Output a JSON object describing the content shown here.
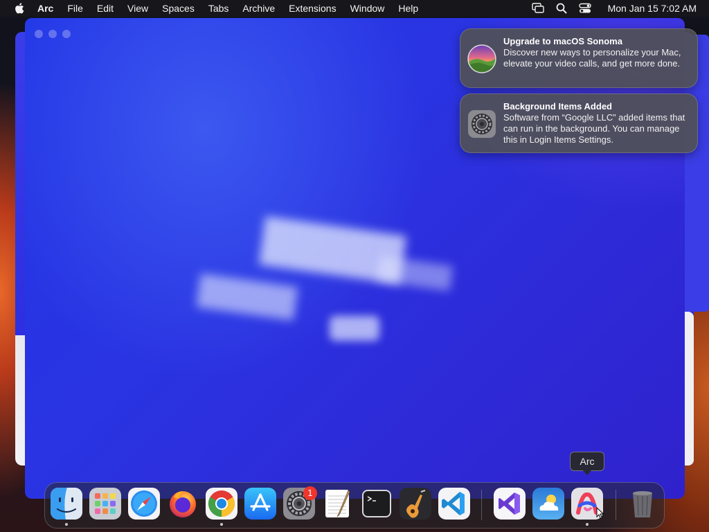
{
  "menubar": {
    "apple_icon": "apple-logo-icon",
    "app_name": "Arc",
    "items": [
      "File",
      "Edit",
      "View",
      "Spaces",
      "Tabs",
      "Archive",
      "Extensions",
      "Window",
      "Help"
    ],
    "status_icons": [
      "screen-mirroring-icon",
      "search-icon",
      "control-center-icon"
    ],
    "clock": "Mon Jan 15  7:02 AM"
  },
  "notifications": [
    {
      "icon": "macos-sonoma-icon",
      "title": "Upgrade to macOS Sonoma",
      "text": "Discover new ways to personalize your Mac, elevate your video calls, and get more done."
    },
    {
      "icon": "system-settings-gear-icon",
      "title": "Background Items Added",
      "text": "Software from “Google LLC” added items that can run in the background. You can manage this in Login Items Settings."
    }
  ],
  "dock": {
    "apps": [
      {
        "name": "Finder",
        "icon": "finder-icon",
        "running": true
      },
      {
        "name": "Launchpad",
        "icon": "launchpad-icon",
        "running": false
      },
      {
        "name": "Safari",
        "icon": "safari-icon",
        "running": false
      },
      {
        "name": "Firefox",
        "icon": "firefox-icon",
        "running": false
      },
      {
        "name": "Google Chrome",
        "icon": "chrome-icon",
        "running": true
      },
      {
        "name": "App Store",
        "icon": "app-store-icon",
        "running": false
      },
      {
        "name": "System Settings",
        "icon": "system-settings-icon",
        "running": false,
        "badge": "1"
      },
      {
        "name": "TextEdit",
        "icon": "textedit-icon",
        "running": false
      },
      {
        "name": "Terminal",
        "icon": "terminal-icon",
        "running": false
      },
      {
        "name": "GarageBand",
        "icon": "garageband-icon",
        "running": false
      },
      {
        "name": "Visual Studio Code",
        "icon": "vscode-icon",
        "running": false
      },
      {
        "name": "Visual Studio",
        "icon": "visual-studio-icon",
        "running": false
      },
      {
        "name": "Weather",
        "icon": "weather-icon",
        "running": false
      },
      {
        "name": "Arc",
        "icon": "arc-icon",
        "running": true
      },
      {
        "name": "Trash",
        "icon": "trash-icon",
        "running": false
      }
    ],
    "tooltip": "Arc"
  },
  "window": {
    "app": "Arc",
    "traffic_lights": [
      "close",
      "minimize",
      "zoom"
    ]
  },
  "colors": {
    "arc_window_blue": "#2a34e2",
    "badge_red": "#f0352c",
    "menubar_bg": "#17171b"
  }
}
